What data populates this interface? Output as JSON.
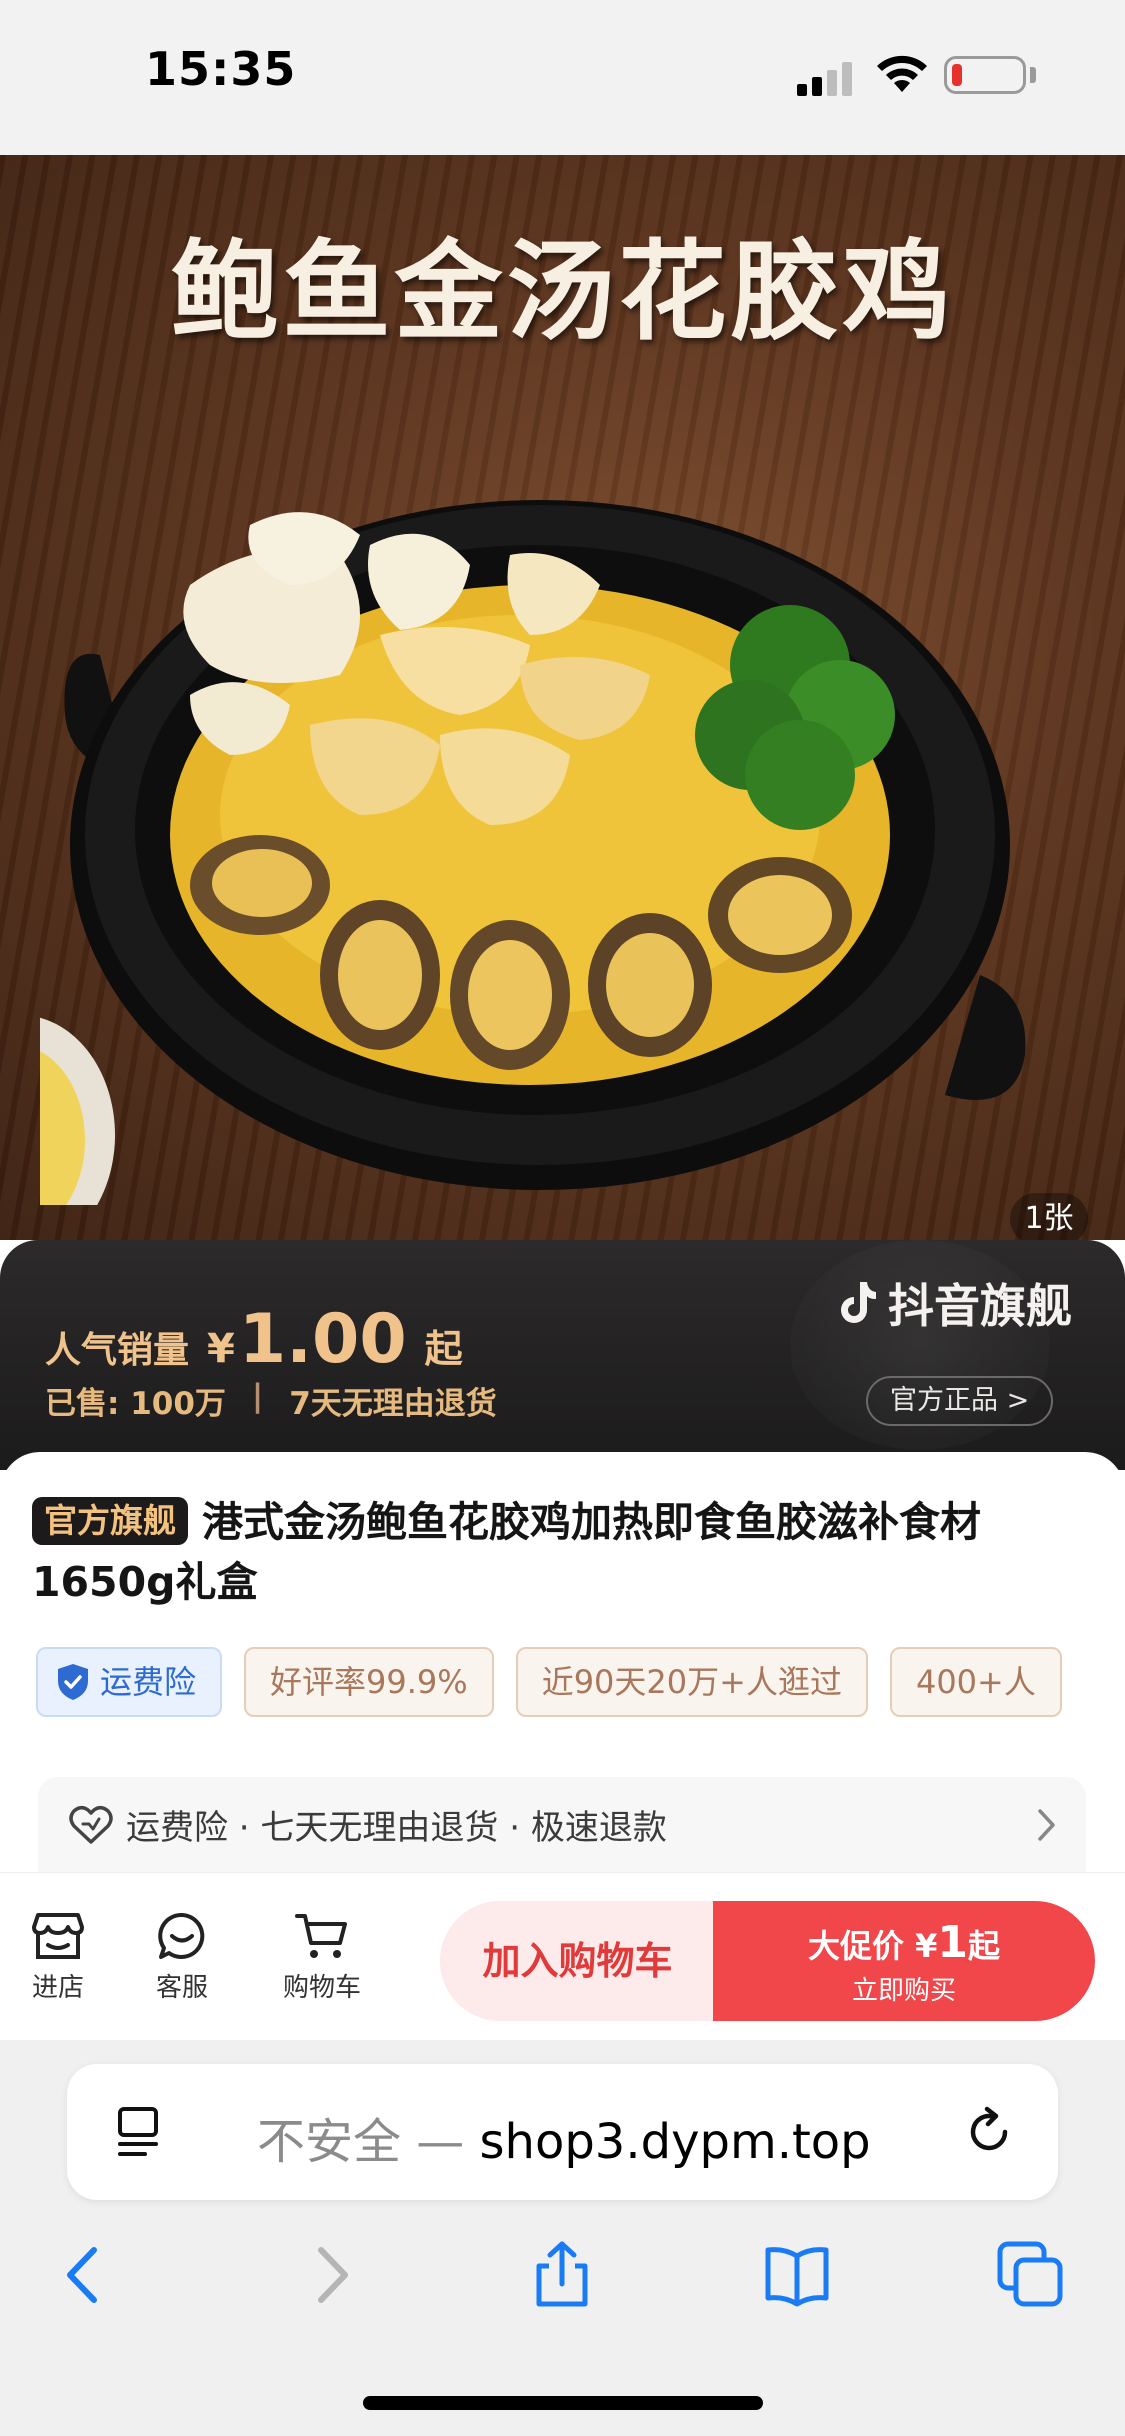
{
  "status_bar": {
    "time": "15:35"
  },
  "hero": {
    "title": "鲍鱼金汤花胶鸡",
    "page_counter": "1张"
  },
  "price_banner": {
    "label": "人气销量",
    "currency": "¥",
    "price": "1.00",
    "suffix": "起",
    "sold": "已售: 100万",
    "separator": "|",
    "return_policy": "7天无理由退货",
    "brand": "抖音旗舰",
    "official_link": "官方正品 >"
  },
  "product": {
    "tag": "官方旗舰",
    "title": "港式金汤鲍鱼花胶鸡加热即食鱼胶滋补食材1650g礼盒",
    "chips": [
      "运费险",
      "好评率99.9%",
      "近90天20万+人逛过",
      "400+人"
    ],
    "service_row": "运费险 · 七天无理由退货 · 极速退款"
  },
  "action_bar": {
    "store": "进店",
    "service": "客服",
    "cart": "购物车",
    "add_to_cart": "加入购物车",
    "buy_prefix": "大促价 ¥",
    "buy_price": "1",
    "buy_suffix": "起",
    "buy_sub": "立即购买"
  },
  "browser": {
    "insecure": "不安全 —",
    "url": "shop3.dypm.top"
  },
  "colors": {
    "accent_red": "#f1474b",
    "gold": "#f0c38d",
    "ios_blue": "#1a7cf5"
  }
}
